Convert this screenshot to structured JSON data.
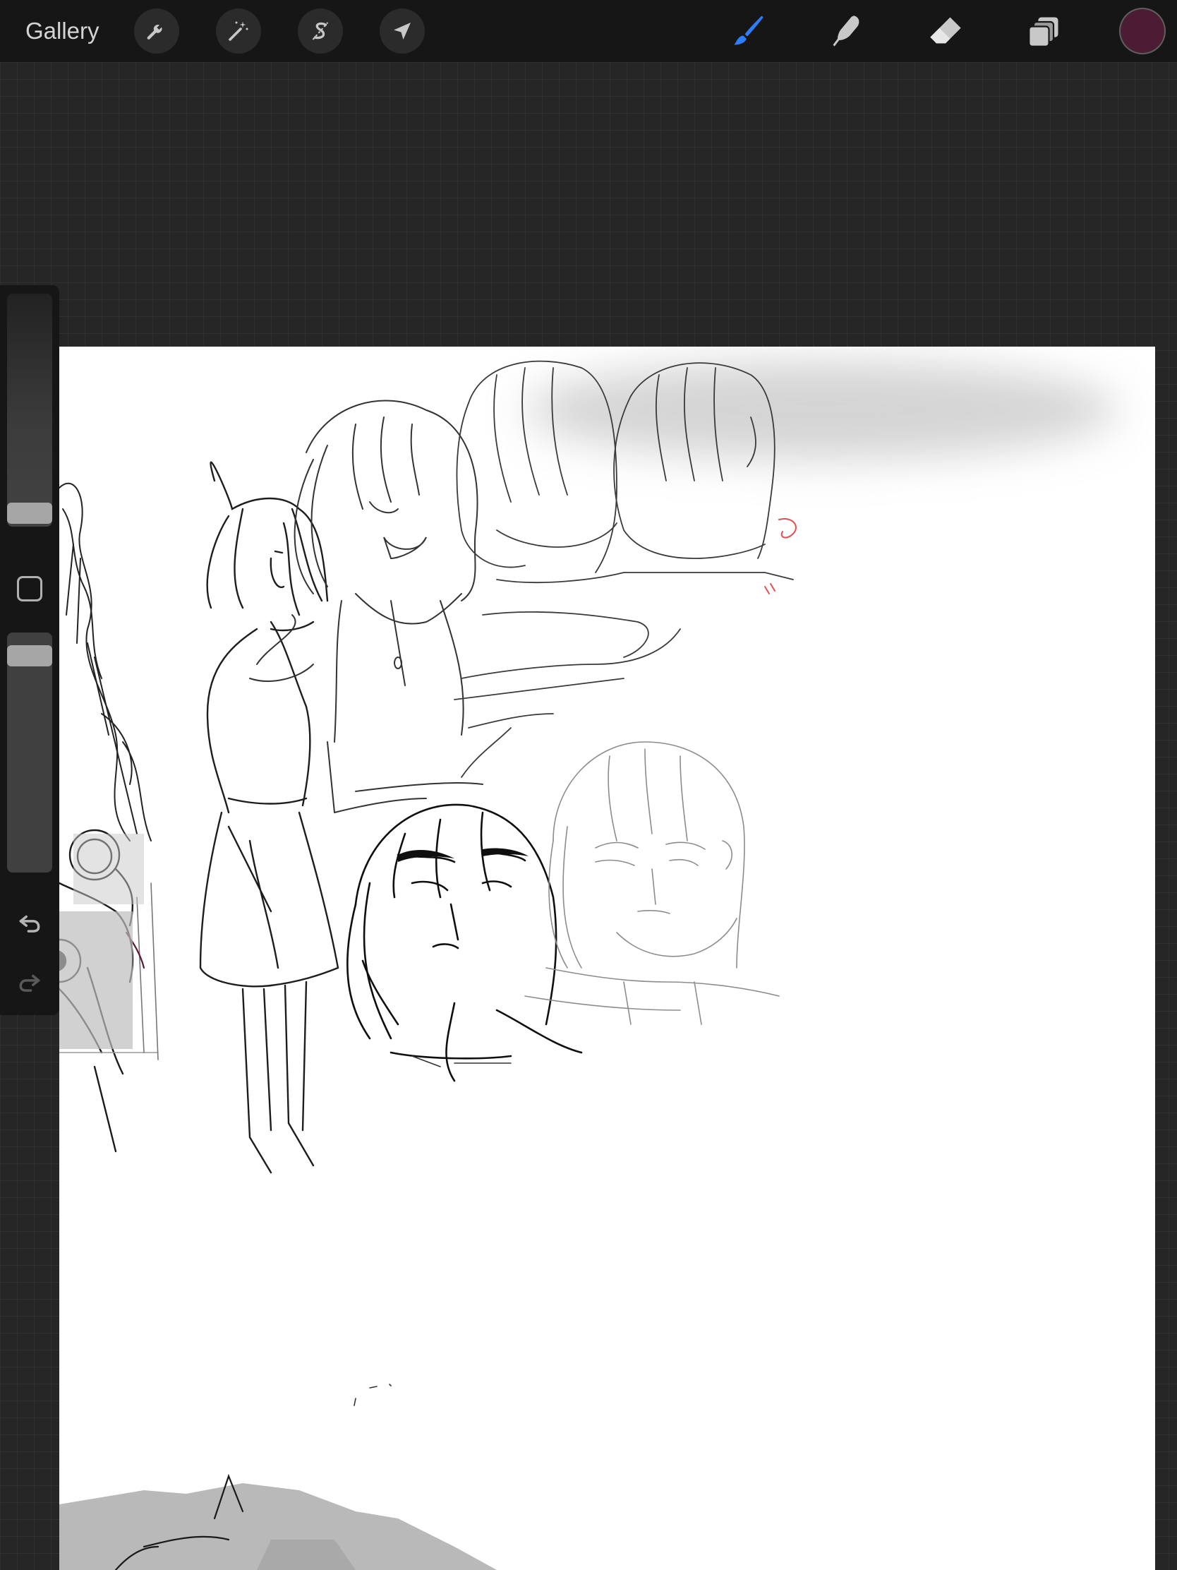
{
  "toolbar": {
    "gallery_label": "Gallery",
    "left_tools": [
      {
        "name": "actions",
        "icon": "wrench-icon"
      },
      {
        "name": "adjustments",
        "icon": "magic-wand-icon"
      },
      {
        "name": "selection",
        "icon": "selection-s-icon"
      },
      {
        "name": "transform",
        "icon": "arrow-cursor-icon"
      }
    ],
    "right_tools": [
      {
        "name": "brush",
        "icon": "brush-icon",
        "active": true
      },
      {
        "name": "smudge",
        "icon": "smudge-finger-icon"
      },
      {
        "name": "eraser",
        "icon": "eraser-icon"
      },
      {
        "name": "layers",
        "icon": "layers-icon"
      }
    ],
    "current_color": "#4b1c34"
  },
  "sidebar": {
    "brush_size": 0.12,
    "opacity": 0.0,
    "controls": [
      "brush-size-slider",
      "modify-button",
      "opacity-slider",
      "undo-icon",
      "redo-icon"
    ]
  },
  "colors": {
    "active_tool": "#2f7dfa",
    "canvas": "#ffffff",
    "workspace": "#262626",
    "toolbar": "#161616"
  }
}
